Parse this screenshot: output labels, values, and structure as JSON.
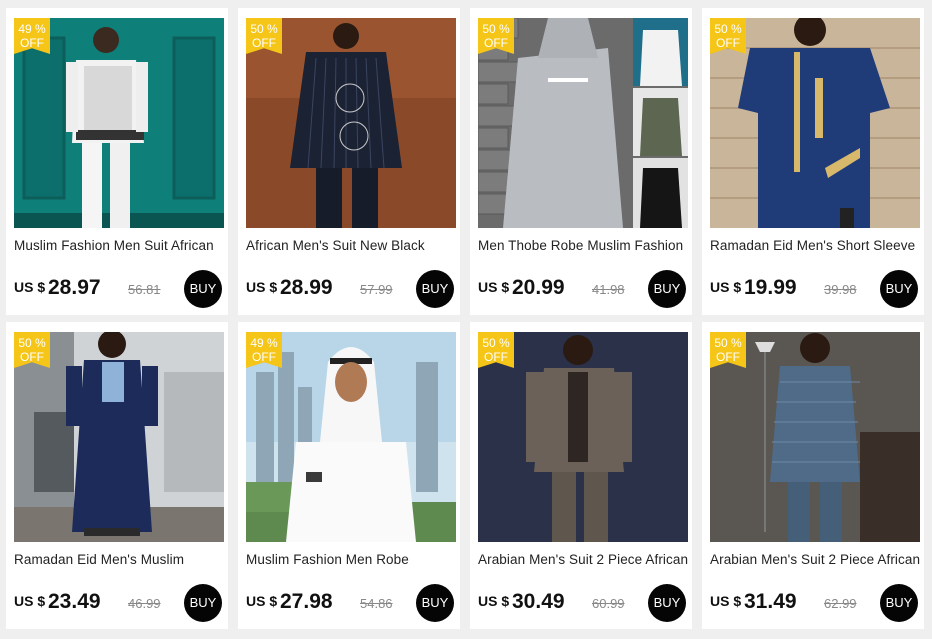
{
  "products": [
    {
      "discount": "49 %",
      "off": "OFF",
      "title": "Muslim Fashion Men Suit African",
      "currency": "US $",
      "price": "28.97",
      "old_price": "56.81",
      "buy": "BUY"
    },
    {
      "discount": "50 %",
      "off": "OFF",
      "title": "African Men's Suit New Black",
      "currency": "US $",
      "price": "28.99",
      "old_price": "57.99",
      "buy": "BUY"
    },
    {
      "discount": "50 %",
      "off": "OFF",
      "title": "Men Thobe Robe Muslim Fashion",
      "currency": "US $",
      "price": "20.99",
      "old_price": "41.98",
      "buy": "BUY"
    },
    {
      "discount": "50 %",
      "off": "OFF",
      "title": "Ramadan Eid Men's Short Sleeve",
      "currency": "US $",
      "price": "19.99",
      "old_price": "39.98",
      "buy": "BUY"
    },
    {
      "discount": "50 %",
      "off": "OFF",
      "title": "Ramadan Eid Men's Muslim",
      "currency": "US $",
      "price": "23.49",
      "old_price": "46.99",
      "buy": "BUY"
    },
    {
      "discount": "49 %",
      "off": "OFF",
      "title": "Muslim Fashion Men Robe",
      "currency": "US $",
      "price": "27.98",
      "old_price": "54.86",
      "buy": "BUY"
    },
    {
      "discount": "50 %",
      "off": "OFF",
      "title": "Arabian Men's Suit 2 Piece African",
      "currency": "US $",
      "price": "30.49",
      "old_price": "60.99",
      "buy": "BUY"
    },
    {
      "discount": "50 %",
      "off": "OFF",
      "title": "Arabian Men's Suit 2 Piece African",
      "currency": "US $",
      "price": "31.49",
      "old_price": "62.99",
      "buy": "BUY"
    }
  ],
  "colors": {
    "badge": "#f5c518",
    "buy_button": "#050505",
    "page_background": "#efefef"
  }
}
